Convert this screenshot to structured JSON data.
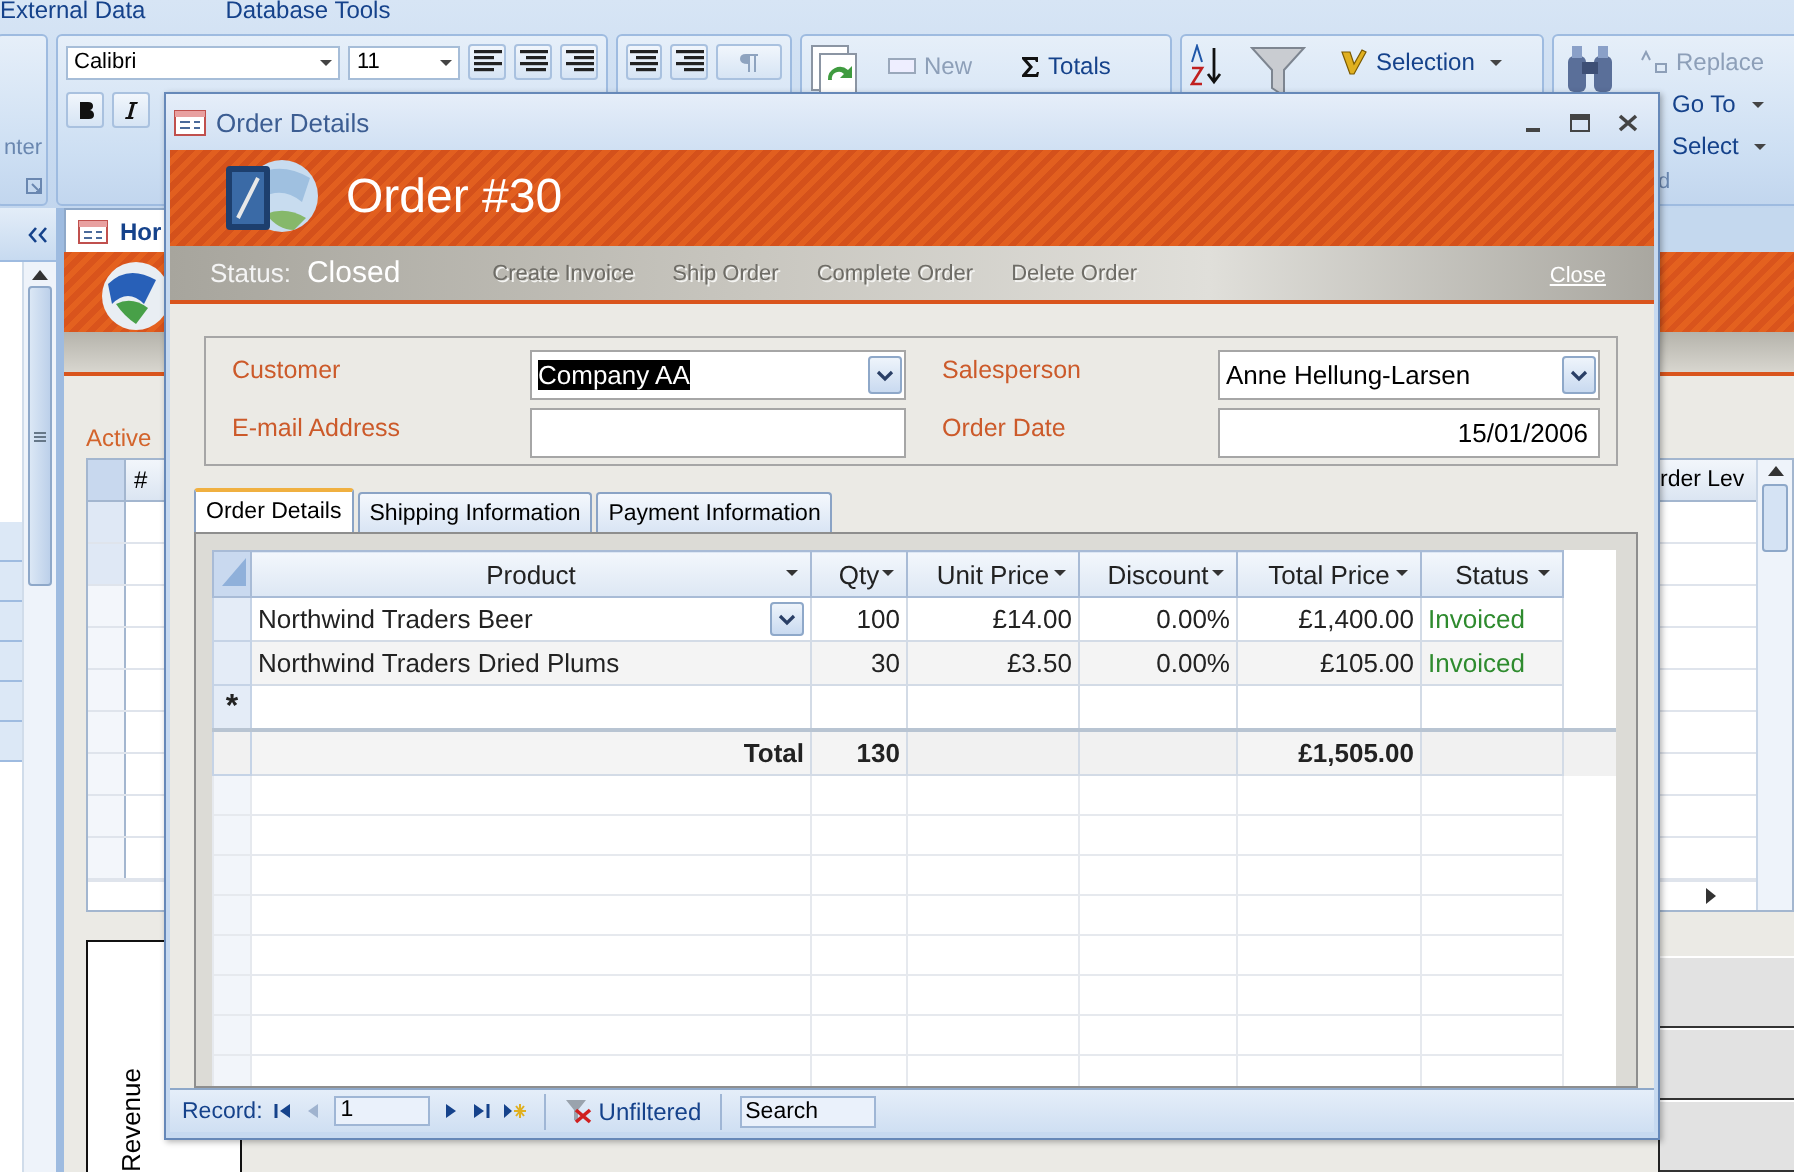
{
  "ribbon": {
    "tabs": [
      "External Data",
      "Database Tools"
    ],
    "group_label_left": "nter",
    "font_name": "Calibri",
    "font_size": "11",
    "group_label_right": "d",
    "buttons": [
      {
        "label": "New",
        "disabled": true
      },
      {
        "label": "Totals",
        "disabled": false
      },
      {
        "label": "Selection",
        "disabled": false
      },
      {
        "label": "Replace",
        "disabled": true
      },
      {
        "label": "Go To",
        "disabled": false
      },
      {
        "label": "Select",
        "disabled": false
      }
    ]
  },
  "background_form": {
    "tab_title": "Hor",
    "section_label": "Active",
    "columns": [
      "#",
      "rder Lev"
    ],
    "chart_label": "Revenue"
  },
  "dialog": {
    "title": "Order Details",
    "heading": "Order #30",
    "status_label": "Status:",
    "status": "Closed",
    "actions": [
      {
        "label": "Create Invoice",
        "disabled": true
      },
      {
        "label": "Ship Order",
        "disabled": true
      },
      {
        "label": "Complete Order",
        "disabled": true
      },
      {
        "label": "Delete Order",
        "disabled": true
      },
      {
        "label": "Close",
        "disabled": false
      }
    ],
    "fields": [
      {
        "label": "Customer",
        "kind": "combo",
        "value": "Company AA",
        "highlighted": true
      },
      {
        "label": "Salesperson",
        "kind": "combo",
        "value": "Anne Hellung-Larsen",
        "highlighted": false
      },
      {
        "label": "E-mail Address",
        "kind": "text"
      },
      {
        "label": "Order Date",
        "kind": "date",
        "value": "15/01/2006",
        "highlighted": false
      }
    ],
    "tabs": [
      {
        "label": "Order Details",
        "selected": true
      },
      {
        "label": "Shipping Information",
        "selected": false
      },
      {
        "label": "Payment Information",
        "selected": false
      }
    ],
    "table": {
      "columns": [
        "Product",
        "Qty",
        "Unit Price",
        "Discount",
        "Total Price",
        "Status"
      ],
      "rows": [
        {
          "cells": [
            "Northwind Traders Beer",
            "100",
            "£14.00",
            "0.00%",
            "£1,400.00",
            "Invoiced"
          ],
          "focused": true
        },
        {
          "cells": [
            "Northwind Traders Dried Plums",
            "30",
            "£3.50",
            "0.00%",
            "£105.00",
            "Invoiced"
          ],
          "focused": false
        }
      ],
      "new_row_marker": "*",
      "totals": {
        "label": "Total",
        "qty": "130",
        "total_price": "£1,505.00"
      }
    },
    "record_nav": {
      "label": "Record:",
      "current": "1",
      "filter": "Unfiltered",
      "search_placeholder": "Search"
    }
  }
}
